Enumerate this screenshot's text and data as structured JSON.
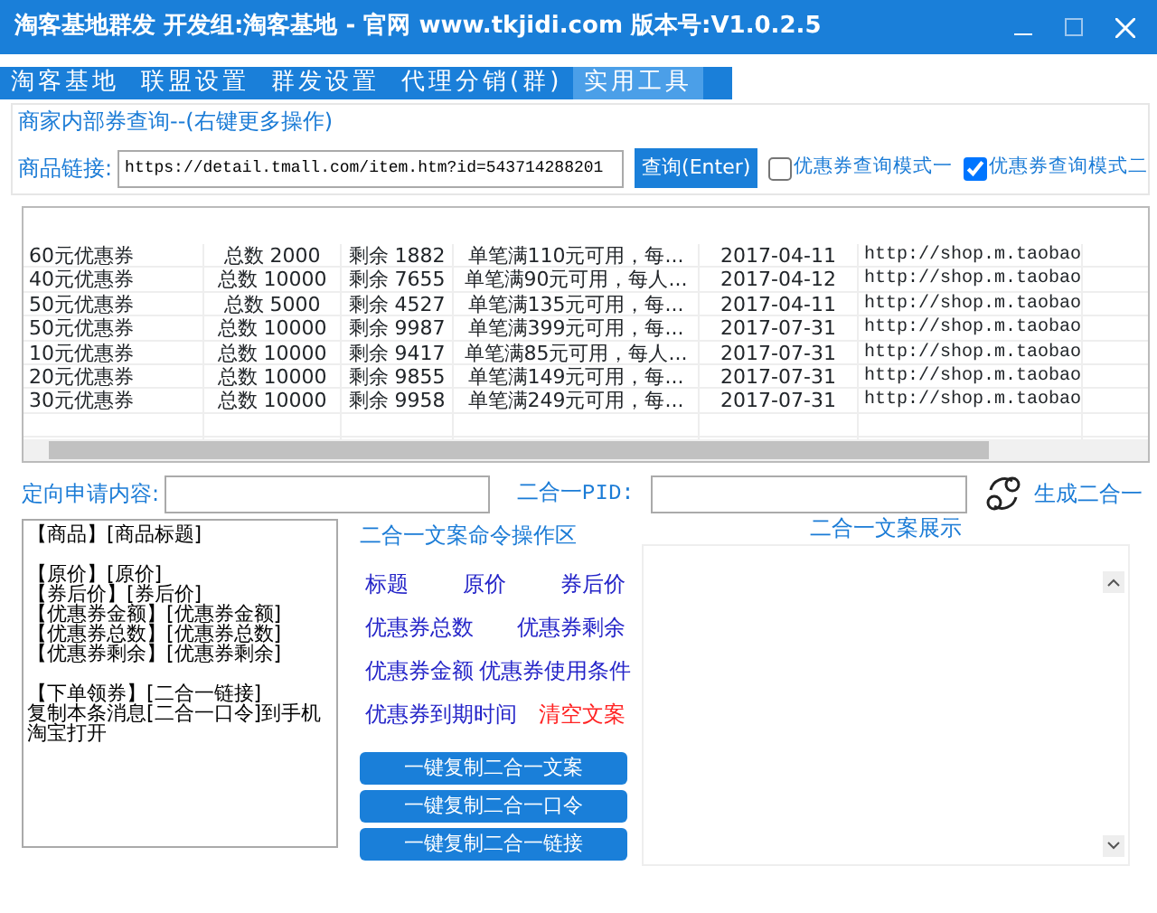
{
  "window": {
    "title": "淘客基地群发 开发组:淘客基地 - 官网 www.tkjidi.com 版本号:V1.0.2.5"
  },
  "tabs": [
    {
      "label": "淘客基地",
      "selected": false
    },
    {
      "label": "联盟设置",
      "selected": false
    },
    {
      "label": "群发设置",
      "selected": false
    },
    {
      "label": "代理分销(群)",
      "selected": false
    },
    {
      "label": "实用工具",
      "selected": true
    }
  ],
  "query": {
    "title": "商家内部券查询--(右键更多操作)",
    "link_label": "商品链接:",
    "link_value": "https://detail.tmall.com/item.htm?id=543714288201",
    "button": "查询(Enter)",
    "modes": [
      {
        "label": "优惠券查询模式一",
        "checked": false
      },
      {
        "label": "优惠券查询模式二",
        "checked": true
      }
    ]
  },
  "table": {
    "rows": [
      [
        "60元优惠券",
        "总数 2000",
        "剩余 1882",
        "单笔满110元可用，每...",
        "2017-04-11",
        "http://shop.m.taobao"
      ],
      [
        "40元优惠券",
        "总数 10000",
        "剩余 7655",
        "单笔满90元可用，每人...",
        "2017-04-12",
        "http://shop.m.taobao"
      ],
      [
        "50元优惠券",
        "总数 5000",
        "剩余 4527",
        "单笔满135元可用，每...",
        "2017-04-11",
        "http://shop.m.taobao"
      ],
      [
        "50元优惠券",
        "总数 10000",
        "剩余 9987",
        "单笔满399元可用，每...",
        "2017-07-31",
        "http://shop.m.taobao"
      ],
      [
        "10元优惠券",
        "总数 10000",
        "剩余 9417",
        "单笔满85元可用，每人...",
        "2017-07-31",
        "http://shop.m.taobao"
      ],
      [
        "20元优惠券",
        "总数 10000",
        "剩余 9855",
        "单笔满149元可用，每...",
        "2017-07-31",
        "http://shop.m.taobao"
      ],
      [
        "30元优惠券",
        "总数 10000",
        "剩余 9958",
        "单笔满249元可用，每...",
        "2017-07-31",
        "http://shop.m.taobao"
      ]
    ]
  },
  "apply": {
    "content_label": "定向申请内容:",
    "pid_label": "二合一PID:",
    "generate": "生成二合一"
  },
  "template": {
    "paragraphs": [
      [
        "【商品】[商品标题]"
      ],
      [
        "【原价】[原价]",
        "【券后价】[券后价]",
        "【优惠券金额】[优惠券金额]",
        "【优惠券总数】[优惠券总数]",
        "【优惠券剩余】[优惠券剩余]"
      ],
      [
        "【下单领券】[二合一链接]",
        "复制本条消息[二合一口令]到手机",
        "淘宝打开"
      ]
    ]
  },
  "commands": {
    "title": "二合一文案命令操作区",
    "rows": [
      [
        {
          "label": "标题",
          "kind": "insert"
        },
        {
          "label": "原价",
          "kind": "insert"
        },
        {
          "label": "券后价",
          "kind": "insert"
        }
      ],
      [
        {
          "label": "优惠券总数",
          "kind": "insert"
        },
        {
          "label": "优惠券剩余",
          "kind": "insert"
        }
      ],
      [
        {
          "label": "优惠券金额",
          "kind": "insert"
        },
        {
          "label": "优惠券使用条件",
          "kind": "insert"
        }
      ],
      [
        {
          "label": "优惠券到期时间",
          "kind": "insert"
        },
        {
          "label": "清空文案",
          "kind": "clear"
        }
      ]
    ],
    "buttons": [
      "一键复制二合一文案",
      "一键复制二合一口令",
      "一键复制二合一链接"
    ]
  },
  "preview": {
    "title": "二合一文案展示"
  }
}
